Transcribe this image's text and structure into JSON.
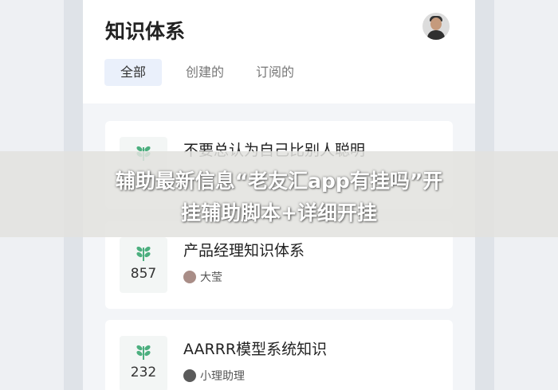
{
  "header": {
    "title": "知识体系",
    "tabs": [
      {
        "label": "全部",
        "active": true
      },
      {
        "label": "创建的",
        "active": false
      },
      {
        "label": "订阅的",
        "active": false
      }
    ]
  },
  "cards": [
    {
      "title": "不要总认为自己比别人聪明",
      "count": "",
      "author": ""
    },
    {
      "title": "产品经理知识体系",
      "count": "857",
      "author": "大莹"
    },
    {
      "title": "AARRR模型系统知识",
      "count": "232",
      "author": "小理助理"
    }
  ],
  "overlay": {
    "line1": "辅助最新信息“老友汇app有挂吗”开",
    "line2": "挂辅助脚本+详细开挂"
  },
  "colors": {
    "accent_tab_bg": "#eaf0fb",
    "leaf": "#4caf7f",
    "background": "#f3f5f8"
  }
}
